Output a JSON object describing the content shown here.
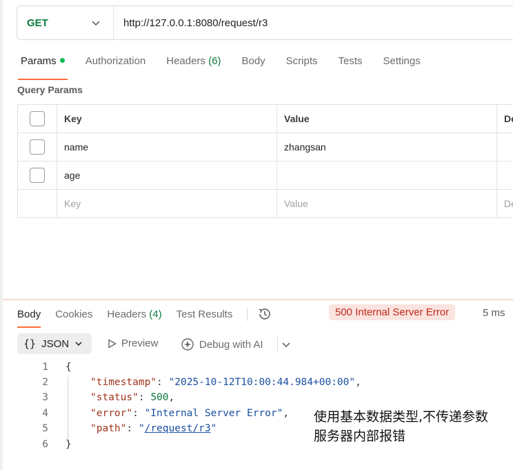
{
  "request": {
    "method": "GET",
    "url": "http://127.0.0.1:8080/request/r3"
  },
  "request_tabs": {
    "params": "Params",
    "authorization": "Authorization",
    "headers": "Headers",
    "headers_count": "(6)",
    "body": "Body",
    "scripts": "Scripts",
    "tests": "Tests",
    "settings": "Settings"
  },
  "query_params": {
    "title": "Query Params",
    "columns": {
      "key": "Key",
      "value": "Value",
      "description": "De"
    },
    "rows": [
      {
        "key": "name",
        "value": "zhangsan",
        "checked": false
      },
      {
        "key": "age",
        "value": "",
        "checked": false
      }
    ],
    "placeholder": {
      "key": "Key",
      "value": "Value",
      "description": "De"
    }
  },
  "response_tabs": {
    "body": "Body",
    "cookies": "Cookies",
    "headers": "Headers",
    "headers_count": "(4)",
    "test_results": "Test Results"
  },
  "response": {
    "status": "500 Internal Server Error",
    "time": "5 ms",
    "format": "JSON",
    "preview": "Preview",
    "debug": "Debug with AI"
  },
  "code": {
    "line_numbers": [
      "1",
      "2",
      "3",
      "4",
      "5",
      "6"
    ],
    "open_brace": "{",
    "close_brace": "}",
    "timestamp_key": "\"timestamp\"",
    "timestamp_value": "\"2025-10-12T10:00:44.984+00:00\"",
    "status_key": "\"status\"",
    "status_value": "500",
    "error_key": "\"error\"",
    "error_value": "\"Internal Server Error\"",
    "path_key": "\"path\"",
    "path_quote": "\"",
    "path_value": "/request/r3"
  },
  "annotation": {
    "line1": "使用基本数据类型,不传递参数",
    "line2": "服务器内部报错"
  },
  "colors": {
    "accent": "#ff6c37",
    "method_green": "#0a7a3c",
    "error_red": "#c0281a",
    "error_bg": "#fbe3df"
  }
}
